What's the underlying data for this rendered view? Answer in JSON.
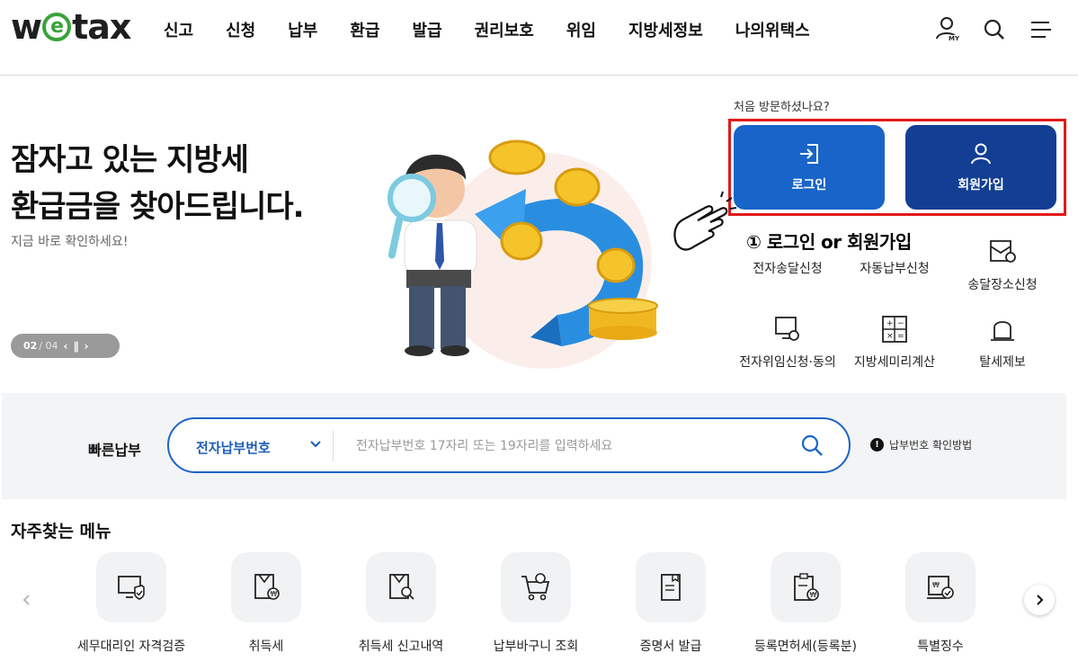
{
  "header": {
    "logo_prefix": "w",
    "logo_e": "e",
    "logo_suffix": "tax",
    "nav": [
      "신고",
      "신청",
      "납부",
      "환급",
      "발급",
      "권리보호",
      "위임",
      "지방세정보",
      "나의위택스"
    ],
    "my_badge": "MY",
    "icons": [
      "user-my-icon",
      "search-icon",
      "hamburger-menu-icon"
    ]
  },
  "hero": {
    "title_line1": "잠자고 있는 지방세",
    "title_line2": "환급금을 찾아드립니다.",
    "subtitle": "지금 바로 확인하세요!",
    "pager_current": "02",
    "pager_total": "/ 04"
  },
  "login_panel": {
    "first_visit": "처음 방문하셨나요?",
    "login_label": "로그인",
    "join_label": "회원가입",
    "annotation": "① 로그인 or 회원가입"
  },
  "services": [
    {
      "label": "전자송달신청",
      "icon": "e-delivery-icon"
    },
    {
      "label": "자동납부신청",
      "icon": "auto-payment-icon"
    },
    {
      "label": "송달장소신청",
      "icon": "delivery-location-icon"
    },
    {
      "label": "전자위임신청·동의",
      "icon": "e-delegation-icon"
    },
    {
      "label": "지방세미리계산",
      "icon": "calculator-icon"
    },
    {
      "label": "탈세제보",
      "icon": "bell-report-icon"
    }
  ],
  "quick_pay": {
    "label": "빠른납부",
    "select_value": "전자납부번호",
    "placeholder": "전자납부번호 17자리 또는 19자리를 입력하세요",
    "help_text": "납부번호 확인방법",
    "help_badge": "!"
  },
  "frequent": {
    "title": "자주찾는 메뉴",
    "items": [
      {
        "label": "세무대리인 자격검증",
        "icon": "monitor-shield-icon"
      },
      {
        "label": "취득세",
        "icon": "acquisition-tax-icon"
      },
      {
        "label": "취득세 신고내역",
        "icon": "document-search-icon"
      },
      {
        "label": "납부바구니 조회",
        "icon": "cart-search-icon"
      },
      {
        "label": "증명서 발급",
        "icon": "certificate-icon"
      },
      {
        "label": "등록면허세(등록분)",
        "icon": "clipboard-won-icon"
      },
      {
        "label": "특별징수",
        "icon": "box-check-icon"
      }
    ]
  },
  "colors": {
    "login_blue": "#1864c8",
    "join_navy": "#123e93",
    "highlight_red": "#e01a1a",
    "logo_green": "#3aa33a"
  }
}
